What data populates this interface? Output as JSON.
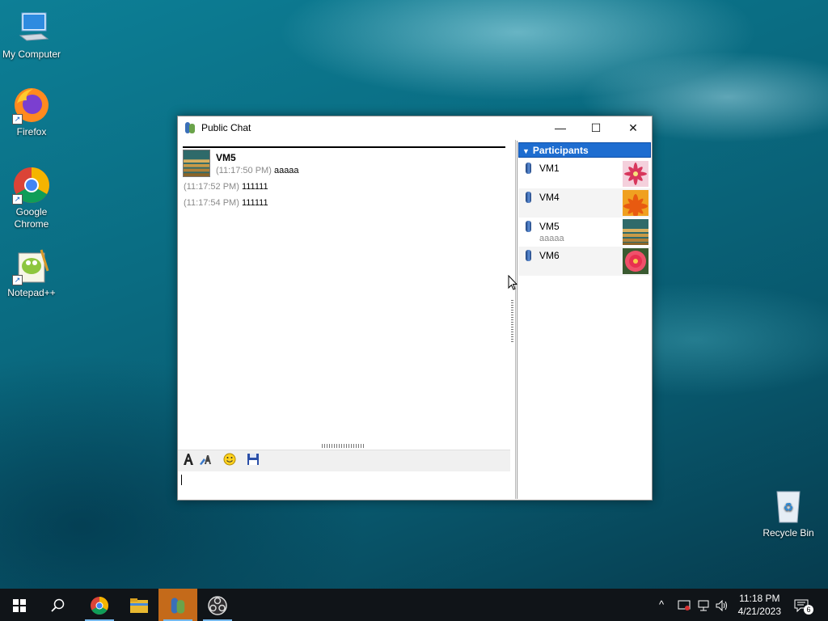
{
  "desktop": {
    "icons": [
      {
        "label": "My Computer"
      },
      {
        "label": "Firefox"
      },
      {
        "label": "Google Chrome"
      },
      {
        "label": "Notepad++"
      },
      {
        "label": "Recycle Bin"
      }
    ]
  },
  "window": {
    "title": "Public Chat",
    "controls": {
      "minimize": "—",
      "maximize": "☐",
      "close": "✕"
    }
  },
  "chat": {
    "sender": "VM5",
    "messages": [
      {
        "time": "(11:17:50 PM)",
        "text": "aaaaa"
      },
      {
        "time": "(11:17:52 PM)",
        "text": "111111"
      },
      {
        "time": "(11:17:54 PM)",
        "text": "111111"
      }
    ],
    "input_value": ""
  },
  "toolbar": {
    "font_icon": "font-icon",
    "font_color_icon": "font-color-icon",
    "emoticon_icon": "smiley-icon",
    "save_icon": "save-icon"
  },
  "participants": {
    "header": "Participants",
    "list": [
      {
        "name": "VM1",
        "status": ""
      },
      {
        "name": "VM4",
        "status": ""
      },
      {
        "name": "VM5",
        "status": "aaaaa"
      },
      {
        "name": "VM6",
        "status": ""
      }
    ]
  },
  "taskbar": {
    "notification_count": "6",
    "time": "11:18 PM",
    "date": "4/21/2023"
  }
}
